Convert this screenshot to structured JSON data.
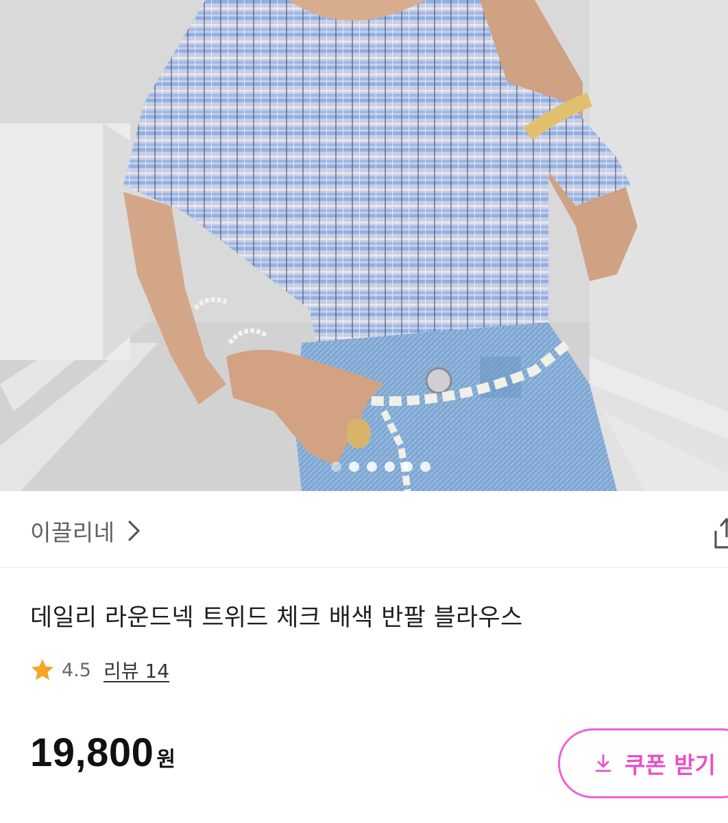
{
  "gallery": {
    "image_alt": "",
    "dot_count": 6,
    "active_index": 0
  },
  "seller": {
    "name": "이끌리네"
  },
  "product": {
    "title": "데일리 라운드넥 트위드 체크 배색 반팔 블라우스",
    "rating": "4.5",
    "review_label": "리뷰 14",
    "price": "19,800",
    "currency": "원"
  },
  "coupon": {
    "label": "쿠폰 받기"
  },
  "colors": {
    "accent": "#e84fc9",
    "star": "#f5a623"
  },
  "icons": [
    "chevron-right-icon",
    "share-icon",
    "star-icon",
    "download-icon"
  ]
}
